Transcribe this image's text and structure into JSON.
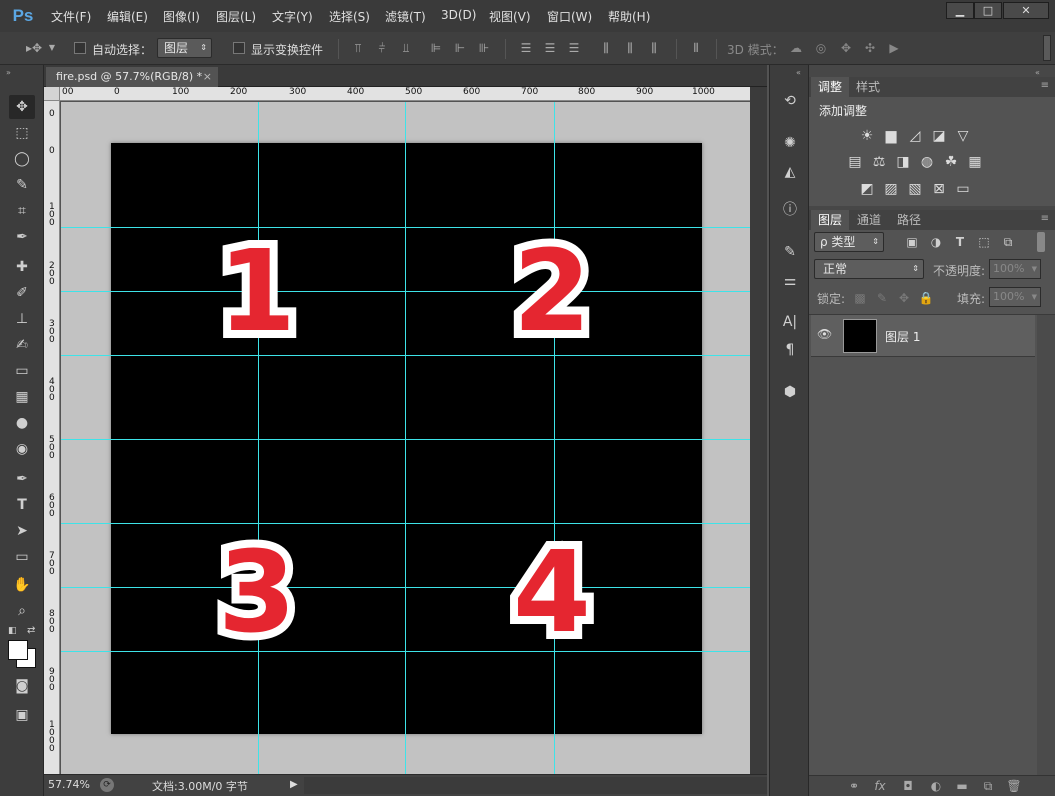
{
  "app": {
    "logo": "Ps"
  },
  "menu": [
    "文件(F)",
    "编辑(E)",
    "图像(I)",
    "图层(L)",
    "文字(Y)",
    "选择(S)",
    "滤镜(T)",
    "3D(D)",
    "视图(V)",
    "窗口(W)",
    "帮助(H)"
  ],
  "window_controls": {
    "minimize": "▁",
    "maximize": "□",
    "close": "✕"
  },
  "options": {
    "auto_select_label": "自动选择：",
    "auto_select_value": "图层",
    "show_transform_label": "显示变换控件",
    "mode_3d_label": "3D 模式："
  },
  "document": {
    "tab_title": "fire.psd @ 57.7%(RGB/8) *",
    "tab_close": "×",
    "zoom": "57.74%",
    "doc_size": "文档:3.00M/0 字节"
  },
  "ruler": {
    "h_labels": [
      "00",
      "0",
      "100",
      "200",
      "300",
      "400",
      "500",
      "600",
      "700",
      "800",
      "900",
      "1000"
    ],
    "v_labels": [
      "0",
      "0",
      "1\n0\n0",
      "2\n0\n0",
      "3\n0\n0",
      "4\n0\n0",
      "5\n0\n0",
      "6\n0\n0",
      "7\n0\n0",
      "8\n0\n0",
      "9\n0\n0",
      "1\n0\n0\n0"
    ]
  },
  "canvas": {
    "numbers": [
      "1",
      "2",
      "3",
      "4"
    ],
    "background": "#000000",
    "guide_color": "#3ee3e8",
    "number_color": "#e52630"
  },
  "panels": {
    "adjust_tabs": [
      "调整",
      "样式"
    ],
    "adjust_title": "添加调整",
    "layers_tabs": [
      "图层",
      "通道",
      "路径"
    ],
    "filter_label": "ρ 类型",
    "blend_mode": "正常",
    "opacity_label": "不透明度:",
    "opacity_value": "100%",
    "lock_label": "锁定:",
    "fill_label": "填充:",
    "fill_value": "100%",
    "layer_name": "图层 1"
  },
  "icons": {
    "move": "move-tool-icon",
    "eye": "visibility-eye-icon"
  }
}
